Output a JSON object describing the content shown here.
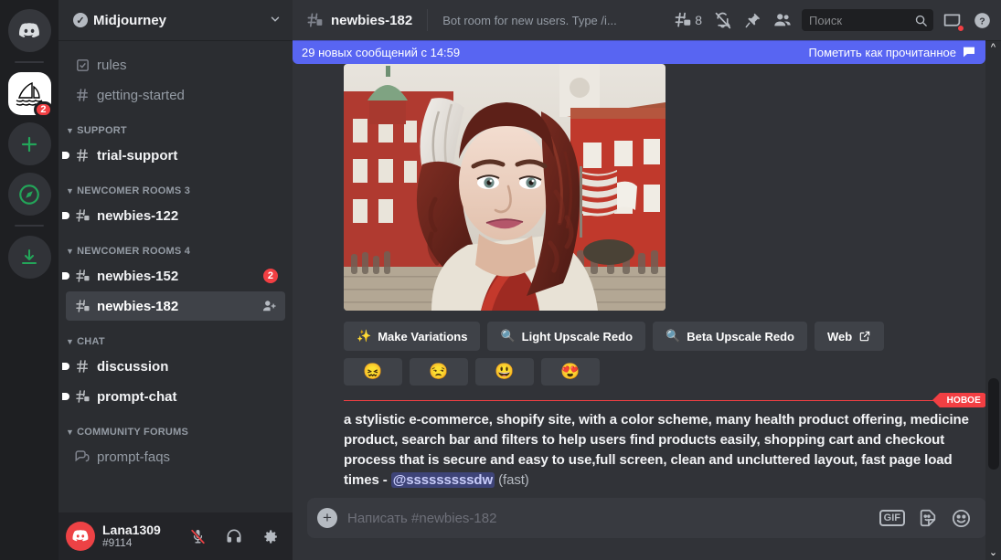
{
  "rail": {
    "items": [
      {
        "name": "home",
        "icon": "discord-logo-icon",
        "label": "Discord"
      },
      {
        "name": "midjourney",
        "icon": "midjourney-sailboat-icon",
        "label": "Midjourney",
        "badge": "2",
        "active": true
      },
      {
        "name": "add-server",
        "icon": "plus-icon",
        "label": "Add a Server"
      },
      {
        "name": "explore",
        "icon": "compass-icon",
        "label": "Explore Public Servers"
      },
      {
        "name": "download",
        "icon": "download-icon",
        "label": "Download Apps"
      }
    ]
  },
  "server": {
    "name": "Midjourney",
    "verified_icon": "check-icon",
    "chevron_icon": "chevron-down-icon"
  },
  "channels": [
    {
      "type": "channel",
      "name": "rules",
      "icon": "rules-channel-icon",
      "state": "muted"
    },
    {
      "type": "channel",
      "name": "getting-started",
      "icon": "hash-icon",
      "state": "muted"
    },
    {
      "type": "category",
      "name": "SUPPORT"
    },
    {
      "type": "channel",
      "name": "trial-support",
      "icon": "hash-icon",
      "state": "unread"
    },
    {
      "type": "category",
      "name": "NEWCOMER ROOMS 3"
    },
    {
      "type": "channel",
      "name": "newbies-122",
      "icon": "hash-locked-icon",
      "state": "unread"
    },
    {
      "type": "category",
      "name": "NEWCOMER ROOMS 4"
    },
    {
      "type": "channel",
      "name": "newbies-152",
      "icon": "hash-locked-icon",
      "state": "unread",
      "badge": "2"
    },
    {
      "type": "channel",
      "name": "newbies-182",
      "icon": "hash-locked-icon",
      "state": "active",
      "trailing_icon": "add-member-icon"
    },
    {
      "type": "category",
      "name": "CHAT"
    },
    {
      "type": "channel",
      "name": "discussion",
      "icon": "hash-icon",
      "state": "unread"
    },
    {
      "type": "channel",
      "name": "prompt-chat",
      "icon": "hash-locked-icon",
      "state": "unread"
    },
    {
      "type": "category",
      "name": "COMMUNITY FORUMS"
    },
    {
      "type": "channel",
      "name": "prompt-faqs",
      "icon": "forum-icon",
      "state": "muted"
    }
  ],
  "user": {
    "name": "Lana1309",
    "tag": "#9114",
    "avatar_icon": "discord-avatar-icon",
    "controls": [
      {
        "name": "mic-muted-icon",
        "label": "Unmute"
      },
      {
        "name": "headphones-icon",
        "label": "Deafen"
      },
      {
        "name": "gear-icon",
        "label": "User Settings"
      }
    ]
  },
  "header": {
    "channel_icon": "hash-locked-icon",
    "channel_name": "newbies-182",
    "topic": "Bot room for new users. Type /i...",
    "threads_icon": "threads-icon",
    "threads_count": "8",
    "notification_icon": "bell-off-icon",
    "pin_icon": "pin-icon",
    "members_icon": "members-icon",
    "search_placeholder": "Поиск",
    "search_icon": "search-icon",
    "inbox_icon": "inbox-icon",
    "help_icon": "help-icon"
  },
  "banner": {
    "text": "29 новых сообщений с 14:59",
    "action": "Пометить как прочитанное",
    "action_icon": "mark-read-icon",
    "color": "#5865f2"
  },
  "message_buttons": [
    {
      "label": "Make Variations",
      "icon": "sparkle-wand-icon"
    },
    {
      "label": "Light Upscale Redo",
      "icon": "magnifier-icon"
    },
    {
      "label": "Beta Upscale Redo",
      "icon": "magnifier-icon"
    },
    {
      "label": "Web",
      "icon": "external-link-icon"
    }
  ],
  "emoji_buttons": [
    {
      "glyph": "😖",
      "name": "confounded-emoji"
    },
    {
      "glyph": "😒",
      "name": "unamused-emoji"
    },
    {
      "glyph": "😃",
      "name": "grinning-emoji"
    },
    {
      "glyph": "😍",
      "name": "heart-eyes-emoji"
    }
  ],
  "new_divider": {
    "label": "НОВОЕ",
    "color": "#f23f43"
  },
  "message": {
    "text": "a stylistic e-commerce, shopify site, with a color scheme, many health product offering, medicine product, search bar and filters to help users find products easily, shopping cart and checkout process that is secure and easy to use,full screen, clean and uncluttered layout, fast page load times - ",
    "mention": "@sssssssssdw",
    "suffix": " (fast)"
  },
  "composer": {
    "placeholder": "Написать #newbies-182",
    "plus_icon": "plus-circle-icon",
    "gif_label": "GIF",
    "sticker_icon": "sticker-icon",
    "emoji_icon": "emoji-icon"
  },
  "scrollbar": {
    "up_icon": "chevron-up-icon",
    "down_icon": "chevron-down-icon"
  }
}
